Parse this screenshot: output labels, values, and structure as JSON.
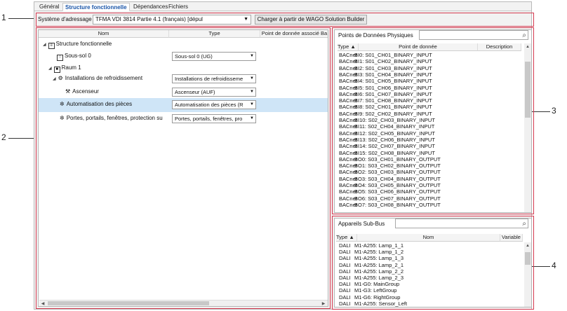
{
  "callouts": [
    "1",
    "2",
    "3",
    "4"
  ],
  "tabs": [
    "Général",
    "Structure fonctionnelle",
    "Dépendances",
    "Fichiers"
  ],
  "address": {
    "label": "Système d'adressage",
    "selected": "TFMA VDI 3814 Partie 4.1 (français) [dépul",
    "load_button": "Charger à partir de WAGO Solution Builder"
  },
  "structure": {
    "columns": [
      "Nom",
      "Type",
      "Point de donnée associé Ba"
    ],
    "rows": [
      {
        "name": "Structure fonctionnelle",
        "icon": "tree-icon",
        "type": ""
      },
      {
        "name": "Sous-sol 0",
        "icon": "floor-icon",
        "type": "Sous-sol 0 (UG)"
      },
      {
        "name": "Raum 1",
        "icon": "room-icon",
        "type": ""
      },
      {
        "name": "Installations de refroidissement",
        "icon": "cooling-icon",
        "type": "Installations de refroidisseme"
      },
      {
        "name": "Ascenseur",
        "icon": "elevator-icon",
        "type": "Ascenseur (AUF)"
      },
      {
        "name": "Automatisation des pièces",
        "icon": "automation-icon",
        "type": "Automatisation des pièces (R"
      },
      {
        "name": "Portes, portails, fenêtres, protection su",
        "icon": "door-icon",
        "type": "Portes, portails, fenêtres, pro"
      }
    ]
  },
  "physical": {
    "title": "Points de Données Physiques",
    "search_placeholder": "",
    "columns": [
      "Type ▲",
      "Point de donnée",
      "Description"
    ],
    "rows": [
      [
        "BACnet",
        "BI0: S01_CH01_BINARY_INPUT"
      ],
      [
        "BACnet",
        "BI1: S01_CH02_BINARY_INPUT"
      ],
      [
        "BACnet",
        "BI2: S01_CH03_BINARY_INPUT"
      ],
      [
        "BACnet",
        "BI3: S01_CH04_BINARY_INPUT"
      ],
      [
        "BACnet",
        "BI4: S01_CH05_BINARY_INPUT"
      ],
      [
        "BACnet",
        "BI5: S01_CH06_BINARY_INPUT"
      ],
      [
        "BACnet",
        "BI6: S01_CH07_BINARY_INPUT"
      ],
      [
        "BACnet",
        "BI7: S01_CH08_BINARY_INPUT"
      ],
      [
        "BACnet",
        "BI8: S02_CH01_BINARY_INPUT"
      ],
      [
        "BACnet",
        "BI9: S02_CH02_BINARY_INPUT"
      ],
      [
        "BACnet",
        "BI10: S02_CH03_BINARY_INPUT"
      ],
      [
        "BACnet",
        "BI11: S02_CH04_BINARY_INPUT"
      ],
      [
        "BACnet",
        "BI12: S02_CH05_BINARY_INPUT"
      ],
      [
        "BACnet",
        "BI13: S02_CH06_BINARY_INPUT"
      ],
      [
        "BACnet",
        "BI14: S02_CH07_BINARY_INPUT"
      ],
      [
        "BACnet",
        "BI15: S02_CH08_BINARY_INPUT"
      ],
      [
        "BACnet",
        "BO0: S03_CH01_BINARY_OUTPUT"
      ],
      [
        "BACnet",
        "BO1: S03_CH02_BINARY_OUTPUT"
      ],
      [
        "BACnet",
        "BO2: S03_CH03_BINARY_OUTPUT"
      ],
      [
        "BACnet",
        "BO3: S03_CH04_BINARY_OUTPUT"
      ],
      [
        "BACnet",
        "BO4: S03_CH05_BINARY_OUTPUT"
      ],
      [
        "BACnet",
        "BO5: S03_CH06_BINARY_OUTPUT"
      ],
      [
        "BACnet",
        "BO6: S03_CH07_BINARY_OUTPUT"
      ],
      [
        "BACnet",
        "BO7: S03_CH08_BINARY_OUTPUT"
      ]
    ]
  },
  "subbus": {
    "title": "Appareils Sub-Bus",
    "search_placeholder": "",
    "columns": [
      "Type ▲",
      "Nom",
      "Variable"
    ],
    "rows": [
      [
        "DALI",
        "M1-A255: Lamp_1_1"
      ],
      [
        "DALI",
        "M1-A255: Lamp_1_2"
      ],
      [
        "DALI",
        "M1-A255: Lamp_1_3"
      ],
      [
        "DALI",
        "M1-A255: Lamp_2_1"
      ],
      [
        "DALI",
        "M1-A255: Lamp_2_2"
      ],
      [
        "DALI",
        "M1-A255: Lamp_2_3"
      ],
      [
        "DALI",
        "M1-G0: MainGroup"
      ],
      [
        "DALI",
        "M1-G3: LeftGroup"
      ],
      [
        "DALI",
        "M1-G6: RightGroup"
      ],
      [
        "DALI",
        "M1-A255: Sensor_Left"
      ]
    ]
  },
  "colors": {
    "highlight": "#d4394f",
    "selection": "#cfe5f7",
    "active_tab": "#1a55a8"
  }
}
